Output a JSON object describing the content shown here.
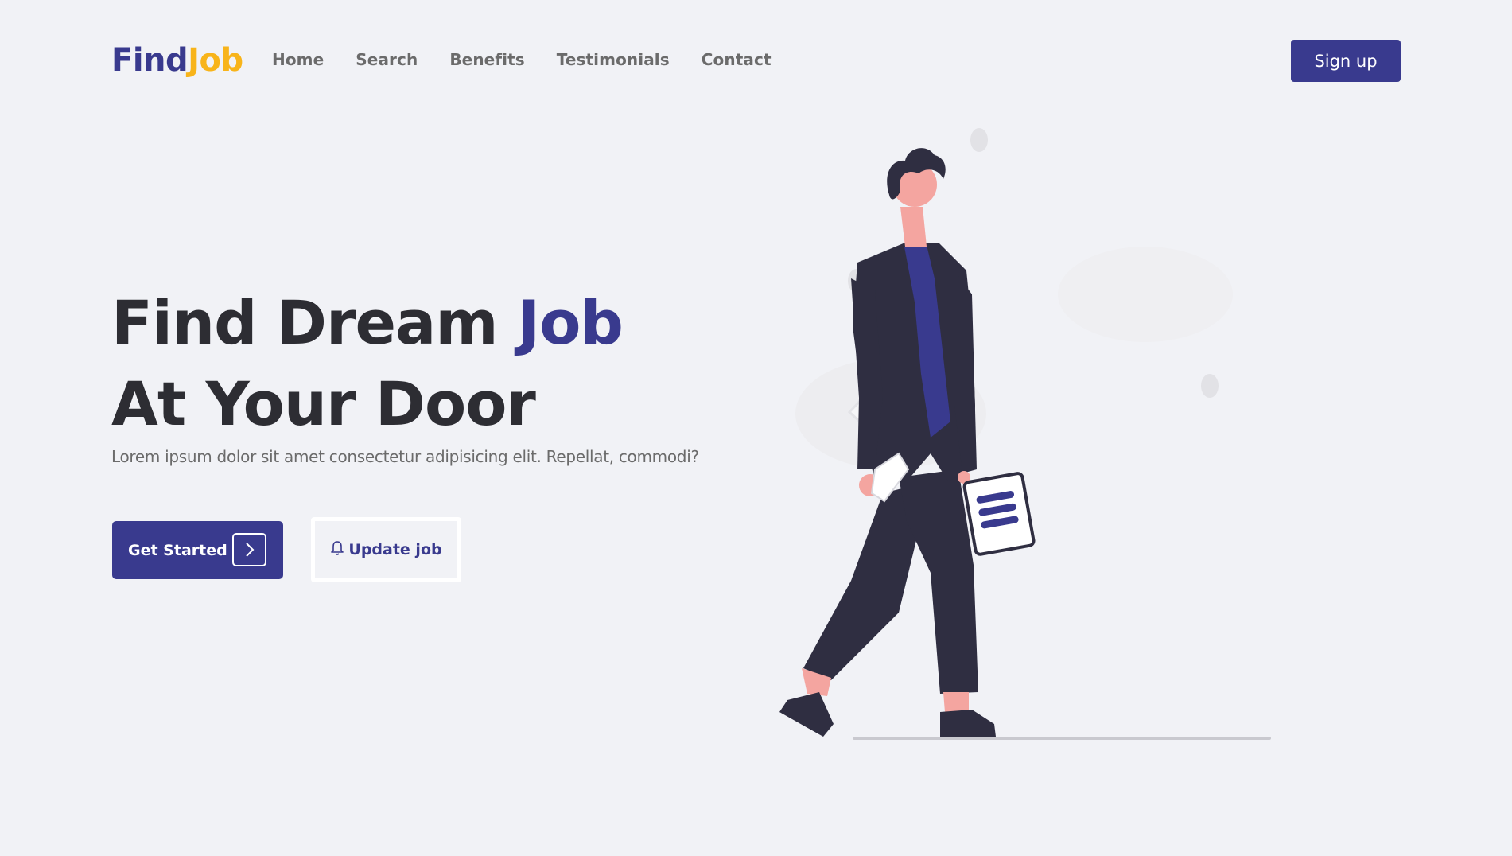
{
  "header": {
    "logo": {
      "part1": "Find",
      "part2": "Job"
    },
    "nav": [
      "Home",
      "Search",
      "Benefits",
      "Testimonials",
      "Contact"
    ],
    "signup_label": "Sign up"
  },
  "hero": {
    "title_line1": "Find Dream",
    "title_accent": "Job",
    "title_line2": "At Your Door",
    "subtitle": "Lorem ipsum dolor sit amet consectetur adipisicing elit. Repellat, commodi?",
    "primary_label": "Get Started",
    "secondary_label": "Update job"
  },
  "icons": {
    "primary_button": "chevron-right-icon",
    "secondary_button": "bell-icon"
  },
  "colors": {
    "background": "#f1f2f6",
    "brand": "#393a8e",
    "accent": "#f8b41a",
    "heading": "#2d2d33",
    "muted": "#6b6b6b"
  }
}
